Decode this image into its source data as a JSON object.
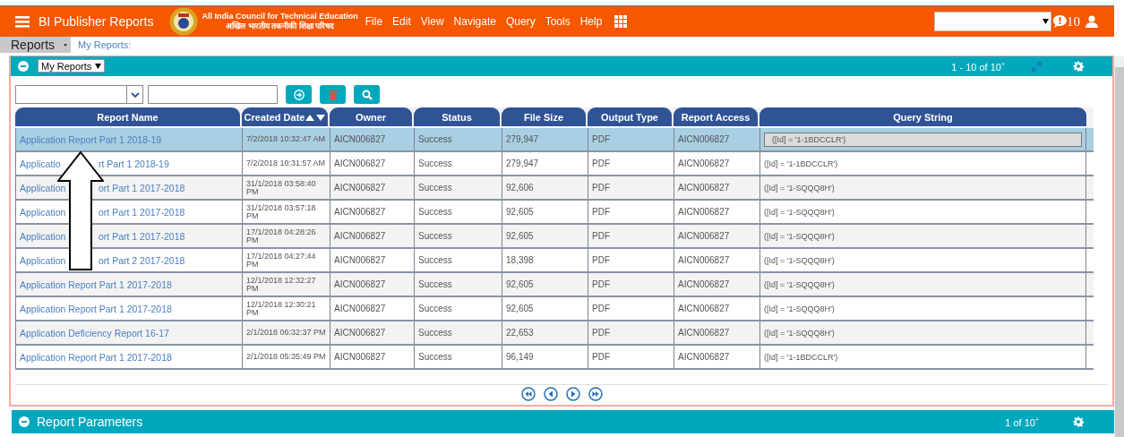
{
  "header": {
    "title": "BI Publisher Reports",
    "logo_lines": [
      "All India Council for Technical Education",
      "अखिल भारतीय तकनीकी शिक्षा परिषद"
    ],
    "menu": [
      "File",
      "Edit",
      "View",
      "Navigate",
      "Query",
      "Tools",
      "Help"
    ],
    "notification_count": "10"
  },
  "breadcrumb": {
    "tab": "Reports",
    "link": "My Reports:"
  },
  "panel": {
    "view_select": "My Reports",
    "range": "1 - 10 of 10$^{+}$"
  },
  "table": {
    "columns": [
      {
        "label": "Report Name",
        "sortable": false
      },
      {
        "label": "Created Date",
        "sortable": true
      },
      {
        "label": "Owner",
        "sortable": false
      },
      {
        "label": "Status",
        "sortable": false
      },
      {
        "label": "File Size",
        "sortable": false
      },
      {
        "label": "Output Type",
        "sortable": false
      },
      {
        "label": "Report Access",
        "sortable": false
      },
      {
        "label": "Query String",
        "sortable": false
      }
    ],
    "rows": [
      {
        "selected": true,
        "cells": [
          "Application Report Part 1 2018-19",
          "7/2/2018 10:32:47 AM",
          "AICN006827",
          "Success",
          "279,947",
          "PDF",
          "AICN006827",
          "([Id] = '1-1BDCCLR')"
        ]
      },
      {
        "selected": false,
        "cells": [
          [
            "Applicatio",
            "rt Part 1 2018-19"
          ],
          "7/2/2018 10:31:57 AM",
          "AICN006827",
          "Success",
          "279,947",
          "PDF",
          "AICN006827",
          "([Id] = '1-1BDCCLR')"
        ]
      },
      {
        "selected": false,
        "cells": [
          [
            "Application",
            "ort Part 1 2017-2018"
          ],
          "31/1/2018 03:58:40 PM",
          "AICN006827",
          "Success",
          "92,606",
          "PDF",
          "AICN006827",
          "([Id] = '1-SQQQ8H')"
        ]
      },
      {
        "selected": false,
        "cells": [
          [
            "Application",
            "ort Part 1 2017-2018"
          ],
          "31/1/2018 03:57:18 PM",
          "AICN006827",
          "Success",
          "92,605",
          "PDF",
          "AICN006827",
          "([Id] = '1-SQQQ8H')"
        ]
      },
      {
        "selected": false,
        "cells": [
          [
            "Application",
            "ort Part 1 2017-2018"
          ],
          "17/1/2018 04:28:26 PM",
          "AICN006827",
          "Success",
          "92,605",
          "PDF",
          "AICN006827",
          "([Id] = '1-SQQQ8H')"
        ]
      },
      {
        "selected": false,
        "cells": [
          [
            "Application",
            "ort Part 2 2017-2018"
          ],
          "17/1/2018 04:27:44 PM",
          "AICN006827",
          "Success",
          "18,398",
          "PDF",
          "AICN006827",
          "([Id] = '1-SQQQ8H')"
        ]
      },
      {
        "selected": false,
        "cells": [
          "Application Report Part 1 2017-2018",
          "12/1/2018 12:32:27 PM",
          "AICN006827",
          "Success",
          "92,605",
          "PDF",
          "AICN006827",
          "([Id] = '1-SQQQ8H')"
        ]
      },
      {
        "selected": false,
        "cells": [
          "Application Report Part 1 2017-2018",
          "12/1/2018 12:30:21 PM",
          "AICN006827",
          "Success",
          "92,605",
          "PDF",
          "AICN006827",
          "([Id] = '1-SQQQ8H')"
        ]
      },
      {
        "selected": false,
        "cells": [
          "Application Deficiency Report 16-17",
          "2/1/2018 06:32:37 PM",
          "AICN006827",
          "Success",
          "22,653",
          "PDF",
          "AICN006827",
          "([Id] = '1-SQQQ8H')"
        ]
      },
      {
        "selected": false,
        "cells": [
          "Application Report Part 1 2017-2018",
          "2/1/2018 05:35:49 PM",
          "AICN006827",
          "Success",
          "96,149",
          "PDF",
          "AICN006827",
          "([Id] = '1-1BDCCLR')"
        ]
      }
    ]
  },
  "params": {
    "title": "Report Parameters",
    "range": "1 of 10$^{+}$"
  }
}
